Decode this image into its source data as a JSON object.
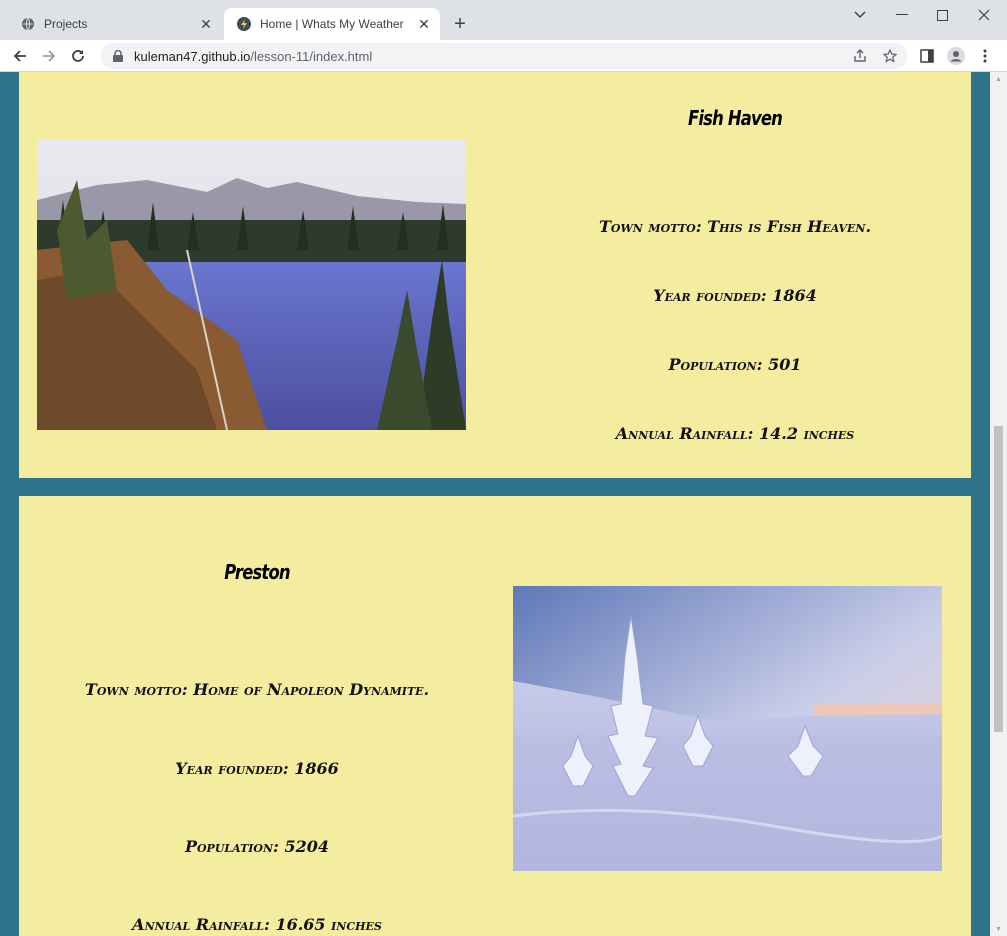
{
  "browser": {
    "tabs": [
      {
        "title": "Projects",
        "active": false,
        "icon": "globe-icon"
      },
      {
        "title": "Home | Whats My Weather",
        "active": true,
        "icon": "lightning-icon"
      }
    ],
    "url_host": "kuleman47.github.io",
    "url_path": "/lesson-11/index.html"
  },
  "towns": [
    {
      "name": "Fish Haven",
      "motto": "Town motto: This is Fish Heaven.",
      "year": "Year founded: 1864",
      "population": "Population: 501",
      "rainfall": "Annual Rainfall: 14.2 inches",
      "image": "lake-landscape-photo"
    },
    {
      "name": "Preston",
      "motto": "Town motto: Home of Napoleon Dynamite.",
      "year": "Year founded: 1866",
      "population": "Population: 5204",
      "rainfall": "Annual Rainfall: 16.65 inches",
      "image": "snowy-landscape-photo"
    }
  ],
  "colors": {
    "page_background": "#2e7389",
    "card_background": "#f4ec9f"
  }
}
